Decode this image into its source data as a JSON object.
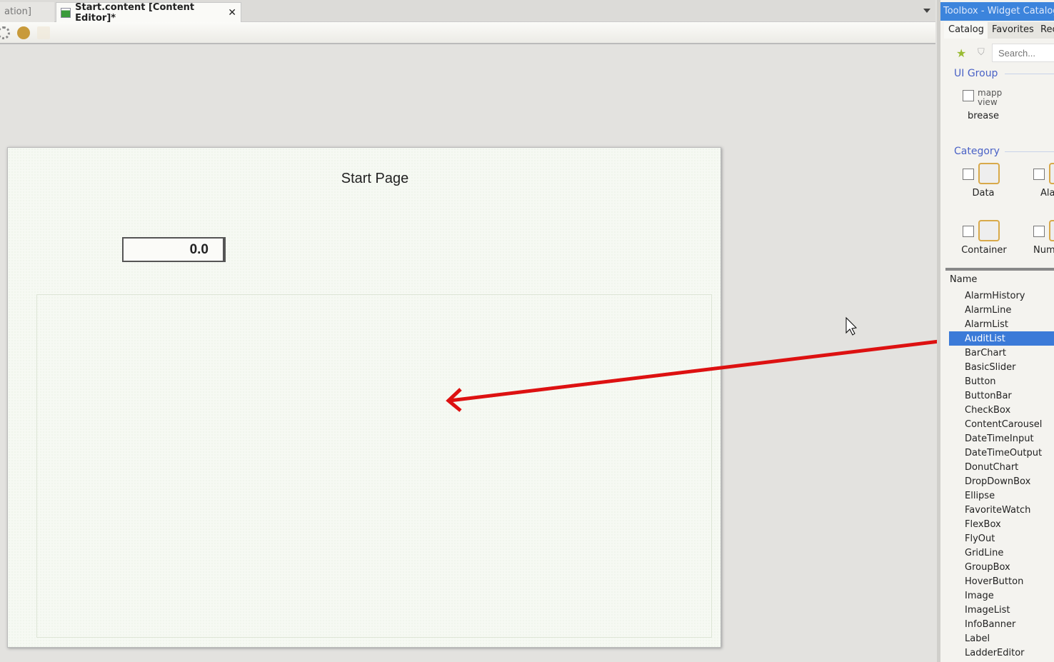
{
  "tabs": {
    "prev": "ation]",
    "active": "Start.content [Content Editor]*",
    "close": "✕"
  },
  "canvas": {
    "title": "Start Page",
    "numeric_value": "0.0"
  },
  "toolbox": {
    "title": "Toolbox - Widget Catalog",
    "tabs": [
      "Catalog",
      "Favorites",
      "Rec"
    ],
    "search_placeholder": "Search...",
    "ui_group": "UI Group",
    "ui_group_item": {
      "logo": "mapp view",
      "label": "brease"
    },
    "category": "Category",
    "categories": [
      "Data",
      "Ala",
      "Container",
      "Num"
    ],
    "list_header": "Name",
    "selected": "AuditList",
    "items": [
      "AlarmHistory",
      "AlarmLine",
      "AlarmList",
      "AuditList",
      "BarChart",
      "BasicSlider",
      "Button",
      "ButtonBar",
      "CheckBox",
      "ContentCarousel",
      "DateTimeInput",
      "DateTimeOutput",
      "DonutChart",
      "DropDownBox",
      "Ellipse",
      "FavoriteWatch",
      "FlexBox",
      "FlyOut",
      "GridLine",
      "GroupBox",
      "HoverButton",
      "Image",
      "ImageList",
      "InfoBanner",
      "Label",
      "LadderEditor"
    ]
  },
  "colors": {
    "selection": "#3b7ad8",
    "annotation_arrow": "#dd1111",
    "title_bar": "#3c84dc"
  }
}
